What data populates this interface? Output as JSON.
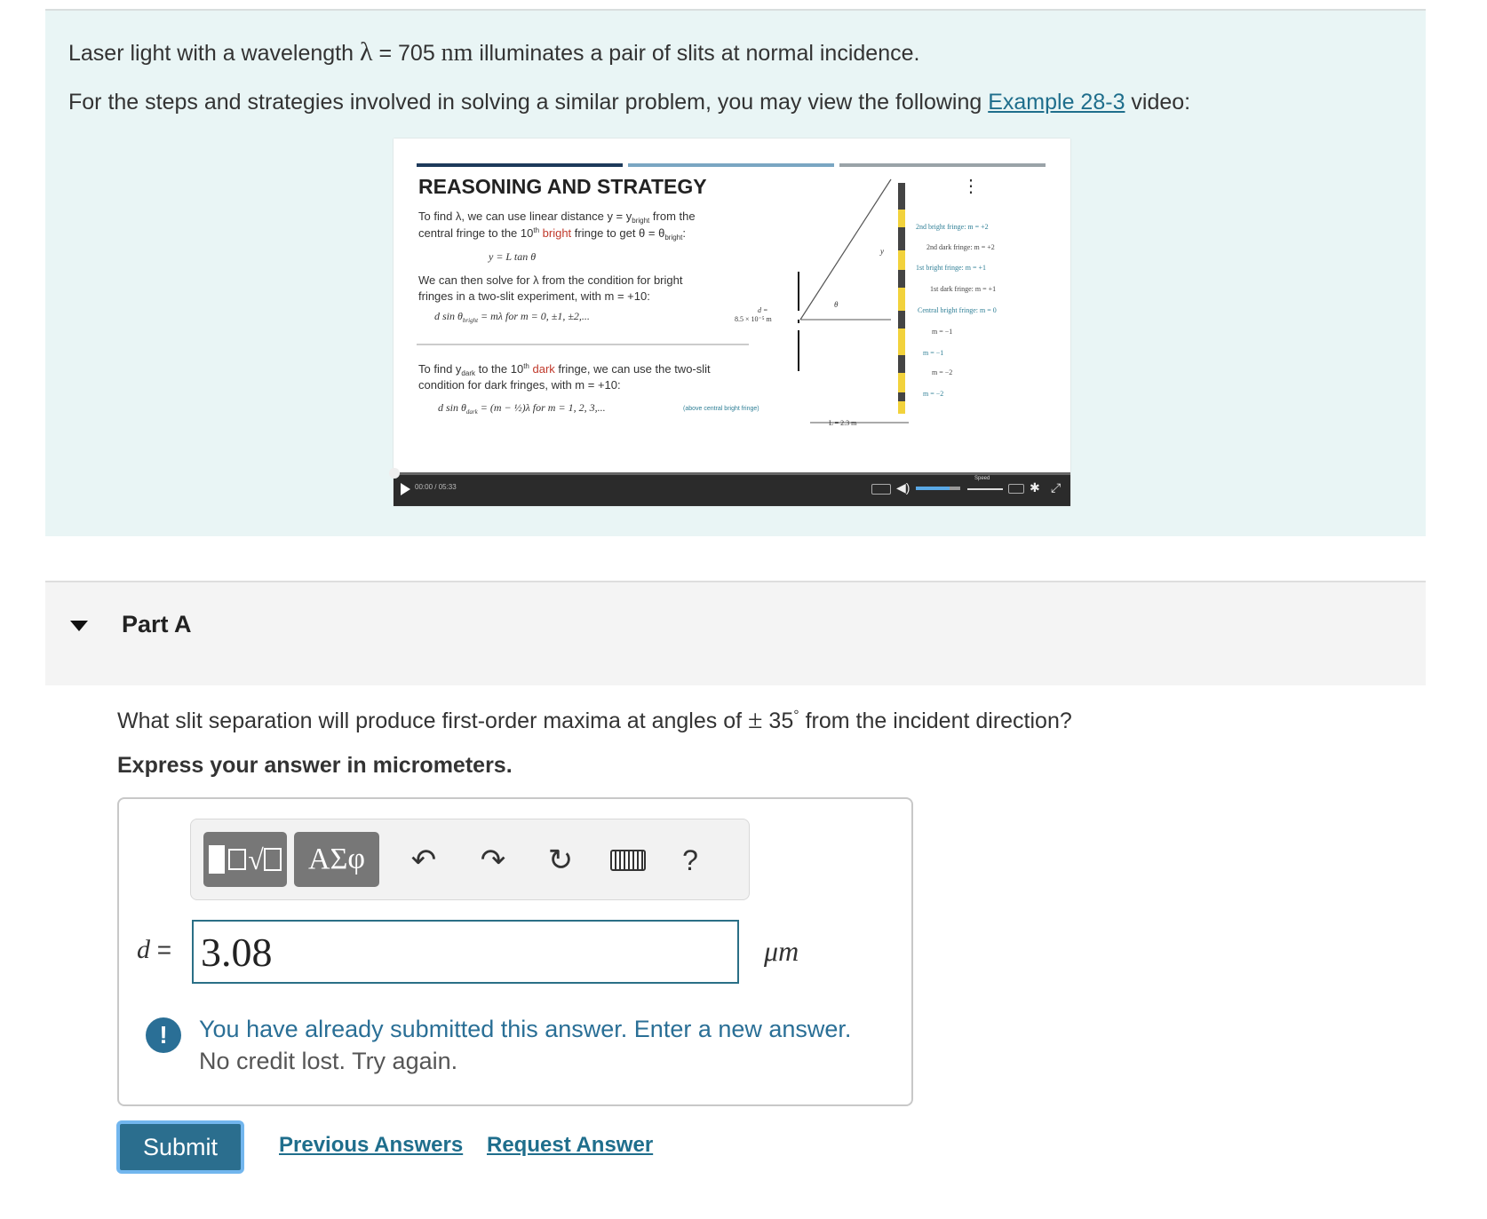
{
  "intro": {
    "line1_pre": "Laser light with a wavelength ",
    "lambda_symbol": "λ",
    "line1_eq": " = 705 ",
    "line1_unit": "nm",
    "line1_post": " illuminates a pair of slits at normal incidence.",
    "line2_pre": "For the steps and strategies involved in solving a similar problem, you may view the following ",
    "line2_link": "Example 28-3",
    "line2_post": " video:"
  },
  "video": {
    "heading": "REASONING AND STRATEGY",
    "para1_l1": "To find λ, we can use linear distance y = y",
    "para1_sub1": "bright",
    "para1_l1b": " from the",
    "para1_l2a": "central fringe to the 10",
    "para1_sup": "th",
    "para1_bright": " bright",
    "para1_l2b": " fringe to get θ = θ",
    "para1_sub2": "bright",
    "para1_l2c": ":",
    "eq1": "y = L tan θ",
    "para2_l1": "We can then solve for λ from the condition for bright",
    "para2_l2": "fringes in a two-slit experiment, with m = +10:",
    "eq2a": "d sin θ",
    "eq2_sub": "bright",
    "eq2b": " = mλ   for   m = 0, ±1, ±2,...",
    "d_label_top": "d =",
    "d_label_bot": "8.5 × 10⁻⁵ m",
    "para3_l1a": "To find y",
    "para3_sub": "dark",
    "para3_l1b": " to the 10",
    "para3_sup": "th",
    "para3_dark": " dark",
    "para3_l1c": " fringe, we can use the two-slit",
    "para3_l2": "condition for dark fringes, with m = +10:",
    "eq3a": "d sin θ",
    "eq3_sub": "dark",
    "eq3b": " = (m − ½)λ   for   m = 1, 2, 3,...",
    "eq3_note": "(above central bright fringe)",
    "theta": "θ",
    "y_label": "y",
    "L_label": "L = 2.3 m",
    "fringes": [
      {
        "text": "2nd bright fringe: m = +2",
        "color": "#2f7f96"
      },
      {
        "text": "2nd dark fringe: m = +2",
        "color": "#444444"
      },
      {
        "text": "1st bright fringe: m = +1",
        "color": "#2f7f96"
      },
      {
        "text": "1st dark fringe: m = +1",
        "color": "#444444"
      },
      {
        "text": "Central bright fringe: m = 0",
        "color": "#2f7f96"
      },
      {
        "text": "m = −1",
        "color": "#444444"
      },
      {
        "text": "m = −1",
        "color": "#2f7f96"
      },
      {
        "text": "m = −2",
        "color": "#444444"
      },
      {
        "text": "m = −2",
        "color": "#2f7f96"
      }
    ],
    "time": "00:00 / 05:33",
    "progress": 0.0,
    "volume": 0.75,
    "speed_label": "Speed"
  },
  "part": {
    "label": "Part A"
  },
  "question": {
    "text_pre": "What slit separation will produce first-order maxima at angles of ",
    "pm": "±",
    "angle": " 35",
    "deg": "°",
    "text_post": " from the incident direction?",
    "instruction": "Express your answer in micrometers."
  },
  "toolbar": {
    "template_label": "√",
    "greek_label": "ΑΣφ",
    "help_label": "?"
  },
  "answer": {
    "var": "d",
    "eq": " =",
    "value": "3.08",
    "unit": "μm"
  },
  "feedback": {
    "icon": "!",
    "line1": "You have already submitted this answer. Enter a new answer.",
    "line2": "No credit lost. Try again."
  },
  "actions": {
    "submit": "Submit",
    "previous": "Previous Answers",
    "request": "Request Answer"
  },
  "colors": {
    "intro_bg": "#e9f5f5",
    "link": "#1f6e8c",
    "submit_bg": "#2b6e8e",
    "feedback_text": "#2a6f96",
    "bright_fringe": "#f2d23c",
    "dark_fringe": "#222222",
    "red_highlight": "#c0392b"
  }
}
